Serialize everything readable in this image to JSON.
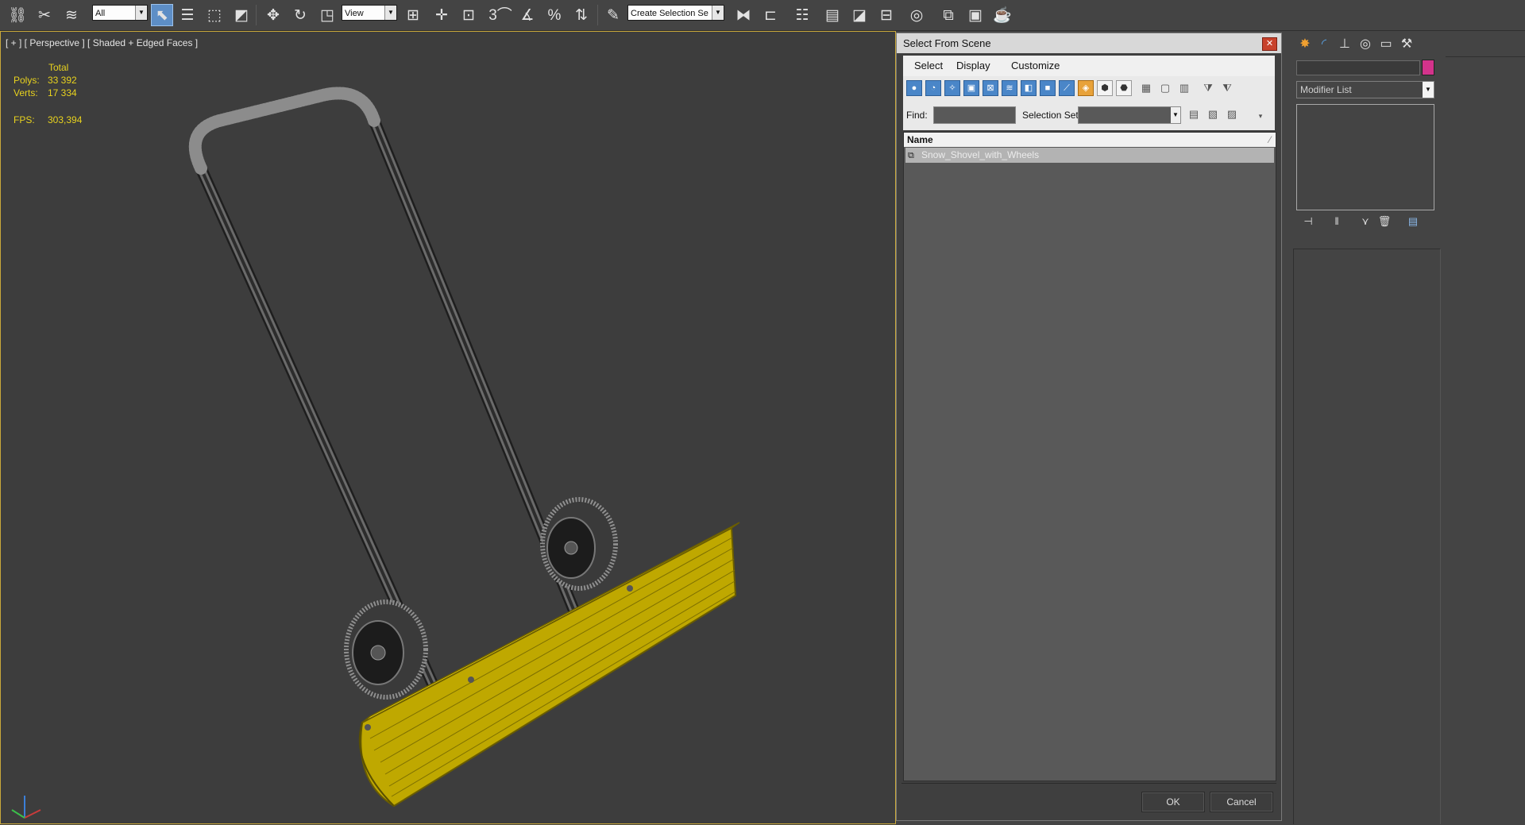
{
  "toolbar": {
    "filter_dropdown": "All",
    "refcoord_dropdown": "View",
    "selection_set_dropdown": "Create Selection Se",
    "snap_3": "3",
    "snap_percent": "%"
  },
  "viewport": {
    "label": "[ + ] [ Perspective ] [ Shaded + Edged Faces ]",
    "stats": {
      "total_label": "Total",
      "polys_label": "Polys:",
      "polys_value": "33 392",
      "verts_label": "Verts:",
      "verts_value": "17 334",
      "fps_label": "FPS:",
      "fps_value": "303,394"
    }
  },
  "dialog": {
    "title": "Select From Scene",
    "close_glyph": "✕",
    "menu": [
      "Select",
      "Display",
      "Customize"
    ],
    "find_label": "Find:",
    "find_value": "",
    "selection_set_label": "Selection Set:",
    "list_header": "Name",
    "rows": [
      "Snow_Shovel_with_Wheels"
    ],
    "ok": "OK",
    "cancel": "Cancel"
  },
  "command_panel": {
    "modifier_list": "Modifier List",
    "object_color": "#d3338b"
  },
  "colors": {
    "accent_blue": "#5d8ec6",
    "viewport_border": "#c9a83a",
    "stats_yellow": "#e8d21e",
    "shovel_yellow": "#c9b000"
  }
}
